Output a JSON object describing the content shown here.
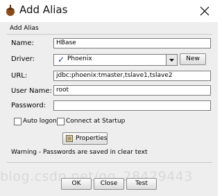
{
  "window": {
    "title": "Add Alias"
  },
  "panel": {
    "label": "Add Alias"
  },
  "fields": {
    "name_label": "Name:",
    "name_value": "HBase",
    "driver_label": "Driver:",
    "driver_value": "Phoenix",
    "url_label": "URL:",
    "url_value": "jdbc:phoenix:tmaster,tslave1,tslave2",
    "user_label": "User Name:",
    "user_value": "root",
    "password_label": "Password:",
    "password_value": ""
  },
  "buttons": {
    "new": "New",
    "properties": "Properties",
    "ok": "OK",
    "close": "Close",
    "test": "Test"
  },
  "options": {
    "auto_logon": "Auto logon",
    "connect_startup": "Connect at Startup"
  },
  "warning": "Warning - Passwords are saved in clear text",
  "watermark": "blog.csdn.net/qq_28429443",
  "icons": {
    "title": "acorn-icon",
    "close": "close-icon",
    "driver_check": "checkmark-icon",
    "dropdown": "chevron-down-icon",
    "properties": "properties-icon"
  }
}
